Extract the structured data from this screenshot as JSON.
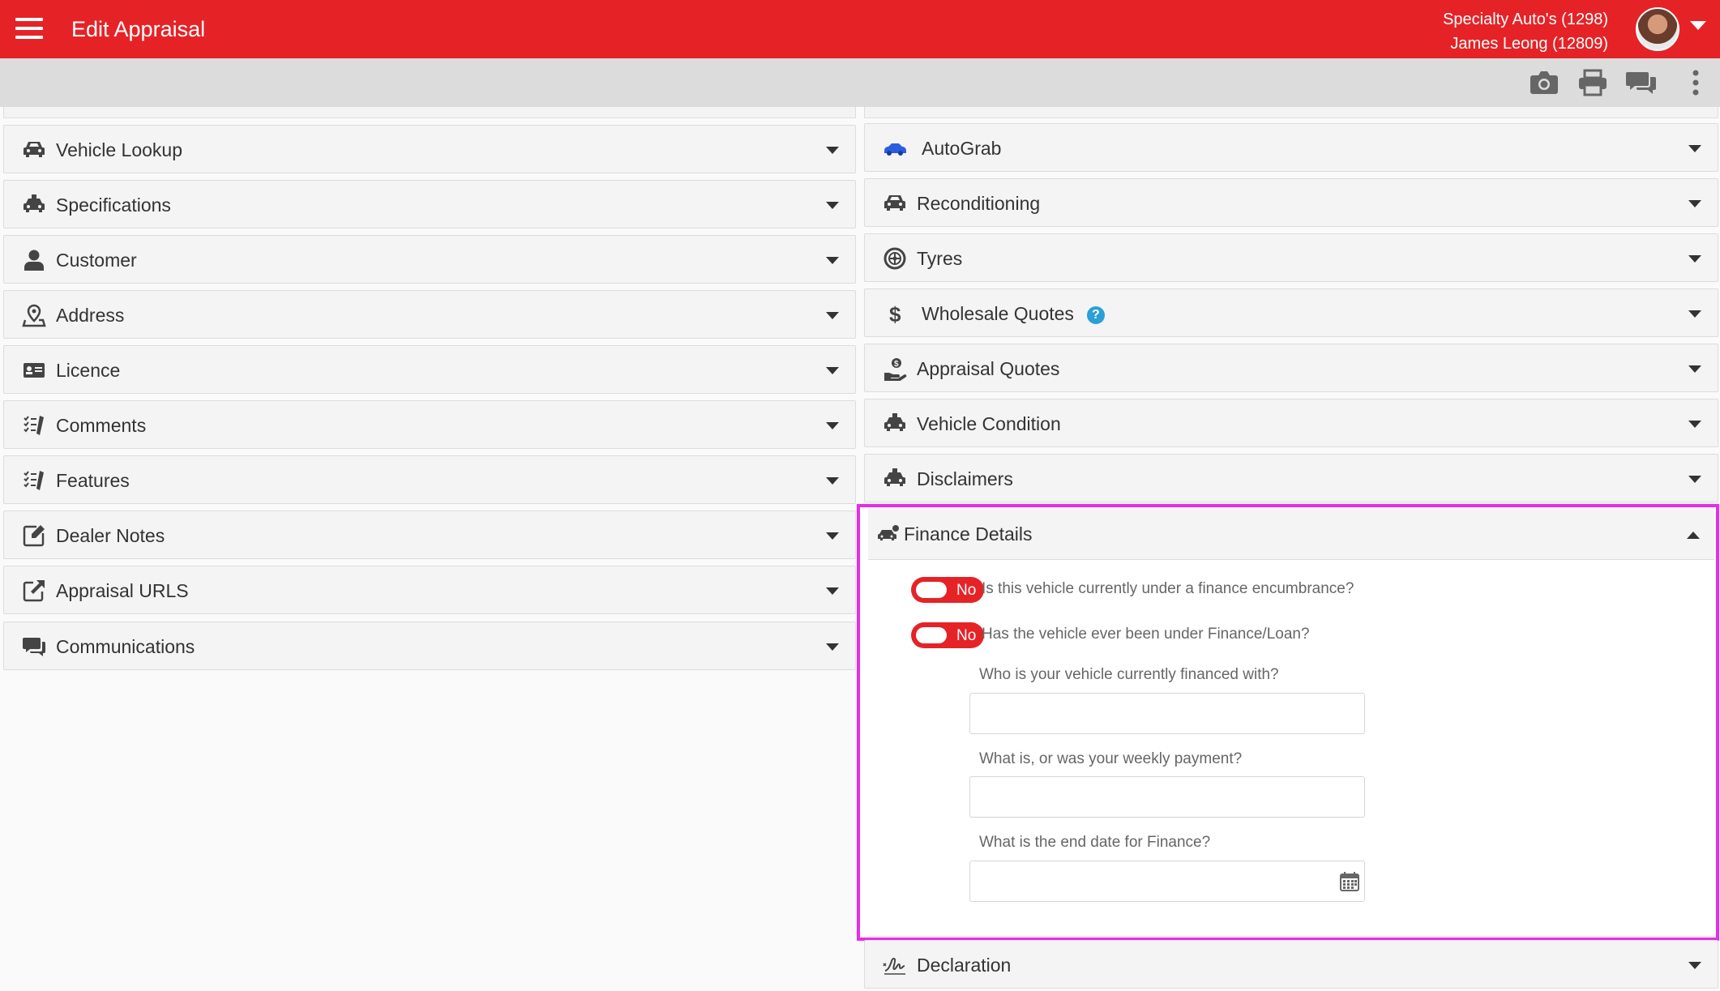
{
  "header": {
    "title": "Edit Appraisal",
    "dealer": "Specialty Auto's (1298)",
    "user": "James Leong (12809)"
  },
  "toolbar": {
    "icons": [
      "camera-icon",
      "print-icon",
      "chat-icon",
      "more-vertical-icon"
    ]
  },
  "left_panels": [
    {
      "label": "Vehicle Lookup",
      "icon": "car-search-icon"
    },
    {
      "label": "Specifications",
      "icon": "car-icon"
    },
    {
      "label": "Customer",
      "icon": "user-icon"
    },
    {
      "label": "Address",
      "icon": "map-pin-icon"
    },
    {
      "label": "Licence",
      "icon": "id-card-icon"
    },
    {
      "label": "Comments",
      "icon": "checklist-icon"
    },
    {
      "label": "Features",
      "icon": "checklist-icon"
    },
    {
      "label": "Dealer Notes",
      "icon": "edit-note-icon"
    },
    {
      "label": "Appraisal URLS",
      "icon": "external-link-icon"
    },
    {
      "label": "Communications",
      "icon": "chat-icon"
    }
  ],
  "right_panels": [
    {
      "label": "AutoGrab",
      "icon": "autograb-car-icon"
    },
    {
      "label": "Reconditioning",
      "icon": "car-search-icon"
    },
    {
      "label": "Tyres",
      "icon": "tyre-icon"
    },
    {
      "label": "Wholesale Quotes",
      "icon": "dollar-icon",
      "help": "?"
    },
    {
      "label": "Appraisal Quotes",
      "icon": "money-hand-icon"
    },
    {
      "label": "Vehicle Condition",
      "icon": "car-icon"
    },
    {
      "label": "Disclaimers",
      "icon": "car-icon"
    }
  ],
  "finance": {
    "label": "Finance Details",
    "q1": {
      "toggle": "No",
      "text": "Is this vehicle currently under a finance encumbrance?"
    },
    "q2": {
      "toggle": "No",
      "text": "Has the vehicle ever been under Finance/Loan?"
    },
    "f1": {
      "label": "Who is your vehicle currently financed with?",
      "value": ""
    },
    "f2": {
      "label": "What is, or was your weekly payment?",
      "value": ""
    },
    "f3": {
      "label": "What is the end date for Finance?",
      "value": ""
    }
  },
  "declaration": {
    "label": "Declaration",
    "icon": "signature-icon"
  },
  "colors": {
    "brand_red": "#e52327",
    "highlight_magenta": "#e72de6",
    "help_blue": "#2a9fd8",
    "autograb_blue": "#2b5de0"
  }
}
